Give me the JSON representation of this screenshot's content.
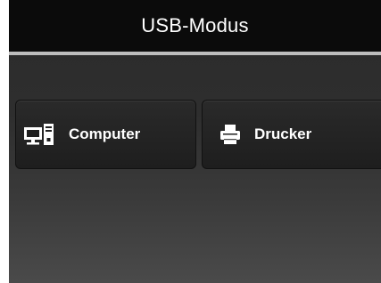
{
  "header": {
    "title": "USB-Modus"
  },
  "options": [
    {
      "label": "Computer",
      "icon": "computer-icon"
    },
    {
      "label": "Drucker",
      "icon": "printer-icon"
    }
  ]
}
